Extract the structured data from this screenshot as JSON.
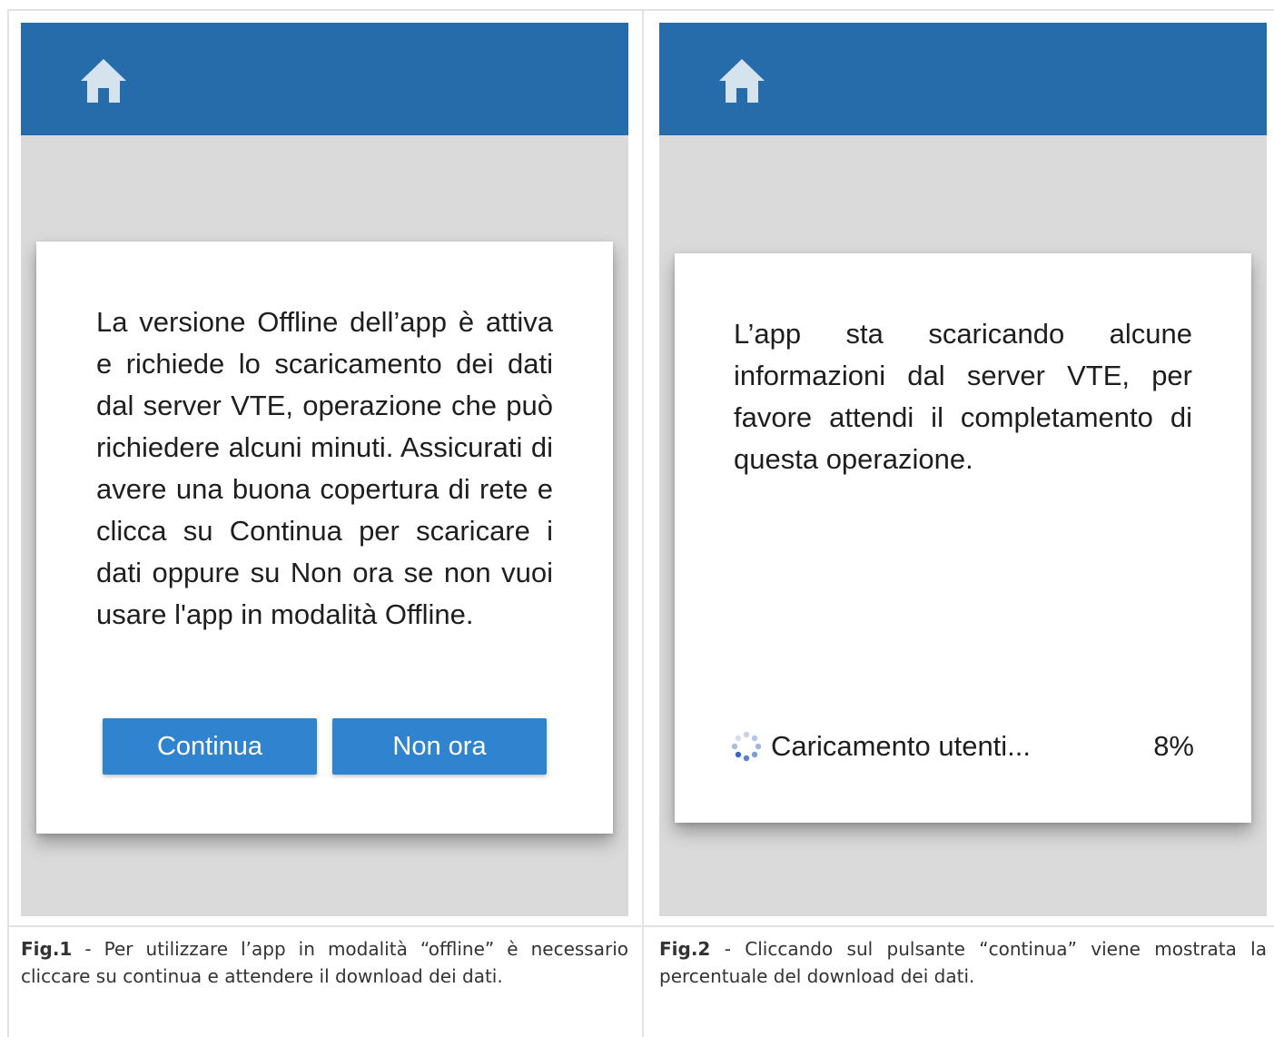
{
  "fig1": {
    "dialog_text": "La versione Offline dell’app è attiva e richiede lo scaricamento dei dati dal server VTE, operazione che può richiedere alcuni minuti. Assicurati di avere una buona copertura di rete e clicca su Continua per scaricare i dati oppure su Non ora se non vuoi usare l'app in modalità Offline.",
    "continue_label": "Continua",
    "not_now_label": "Non ora",
    "caption_label": "Fig.1",
    "caption_text": " - Per utilizzare l’app in modalità “offline” è necessario cliccare su continua e attendere il download dei dati."
  },
  "fig2": {
    "dialog_text": "L’app sta scaricando alcune informazioni dal server VTE, per favore attendi il completamento di questa operazione.",
    "loading_label": "Caricamento utenti...",
    "progress_percent": "8%",
    "caption_label": "Fig.2",
    "caption_text": " - Cliccando sul pulsante “continua” viene mostrata la percentuale del download dei dati."
  },
  "colors": {
    "appbar": "#266caa",
    "button": "#2f83cf",
    "background": "#dadada"
  },
  "icons": {
    "appbar": "home-icon",
    "loader": "spinner-icon"
  }
}
